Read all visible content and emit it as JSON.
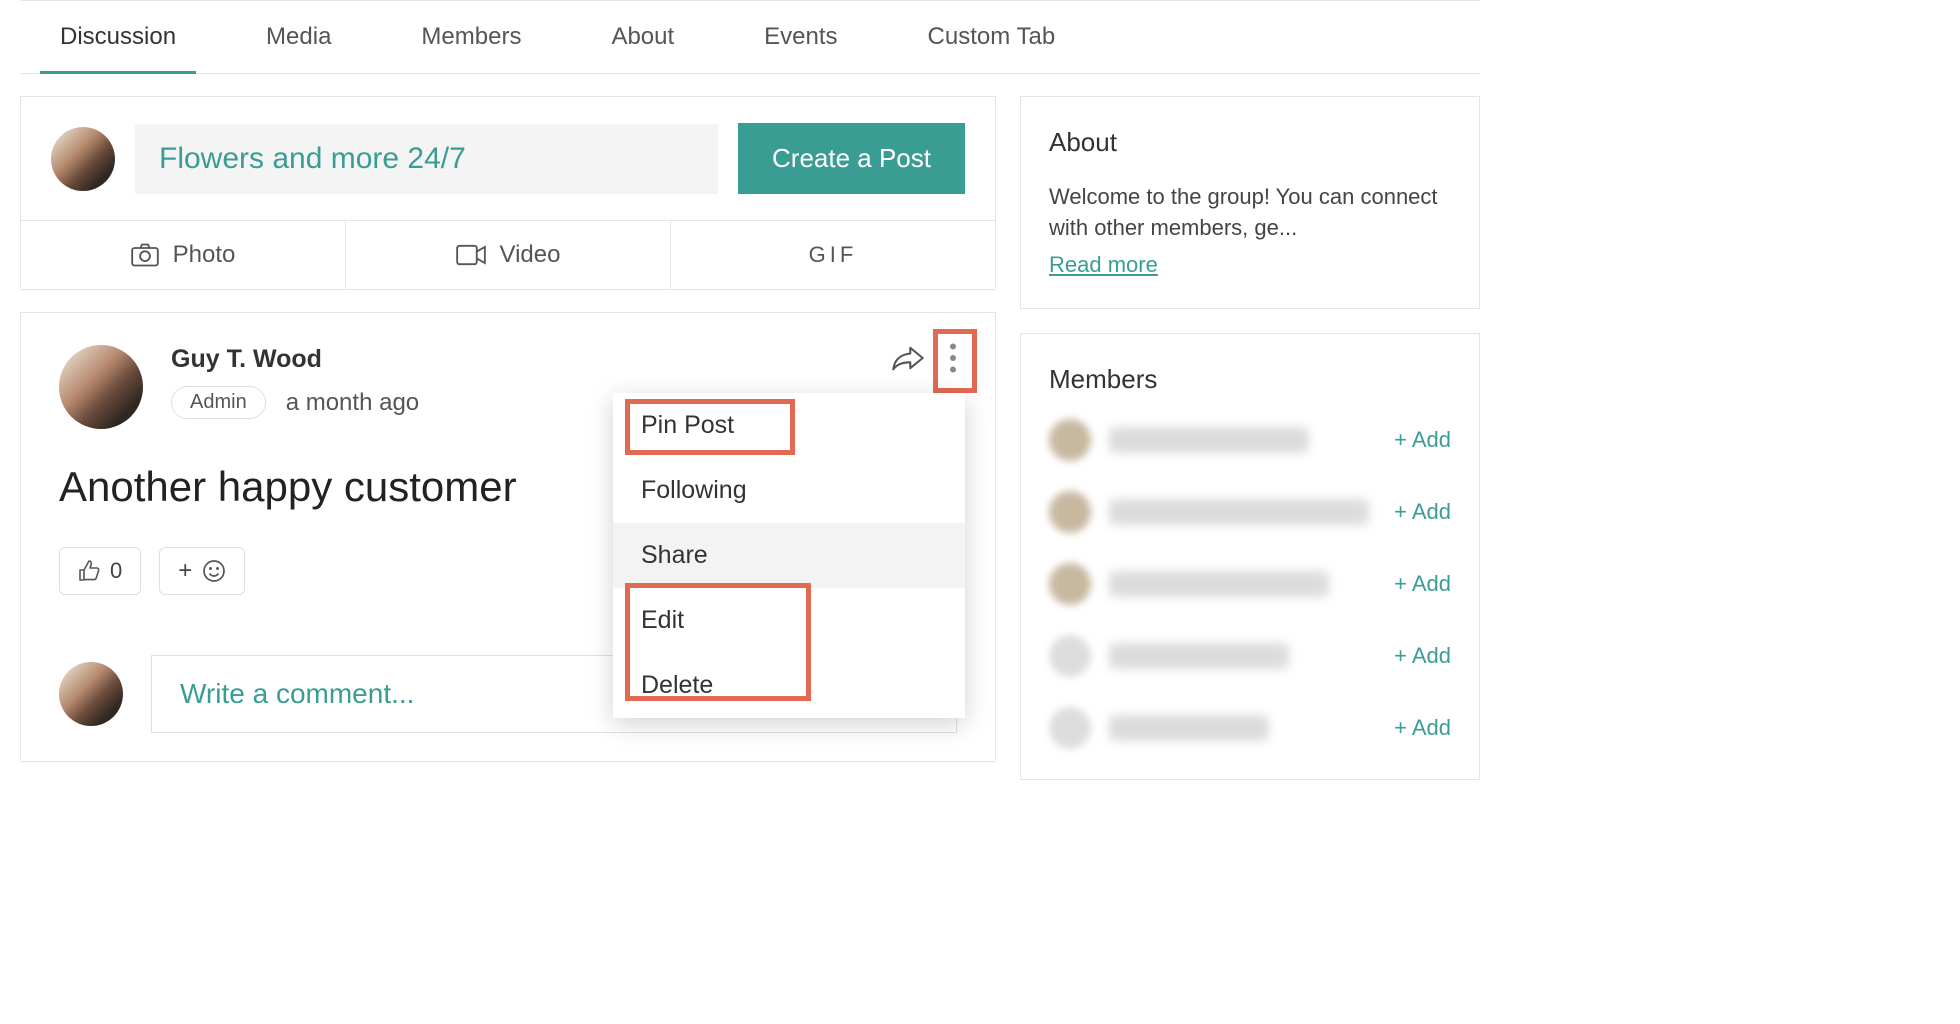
{
  "tabs": {
    "t0": "Discussion",
    "t1": "Media",
    "t2": "Members",
    "t3": "About",
    "t4": "Events",
    "t5": "Custom Tab"
  },
  "compose": {
    "placeholder": "Flowers and more 24/7",
    "create_button": "Create a Post",
    "photo": "Photo",
    "video": "Video",
    "gif": "GIF"
  },
  "post": {
    "author": "Guy T. Wood",
    "badge": "Admin",
    "time": "a month ago",
    "title": "Another happy customer",
    "like_count": "0"
  },
  "menu": {
    "pin": "Pin Post",
    "following": "Following",
    "share": "Share",
    "edit": "Edit",
    "delete": "Delete"
  },
  "comment": {
    "placeholder": "Write a comment..."
  },
  "about": {
    "title": "About",
    "text": "Welcome to the group! You can connect with other members, ge...",
    "read_more": "Read more"
  },
  "members": {
    "title": "Members",
    "add": "+ Add"
  }
}
